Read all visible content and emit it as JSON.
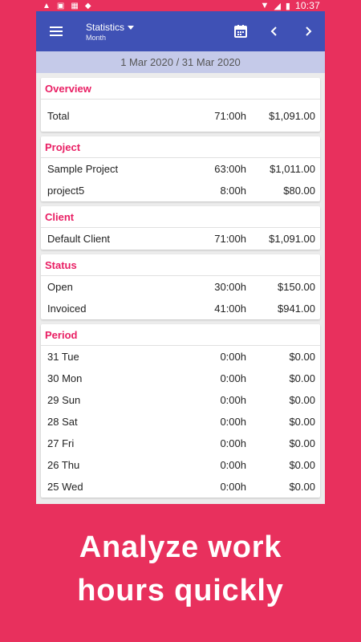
{
  "status_bar": {
    "time": "10:37"
  },
  "appbar": {
    "title": "Statistics",
    "subtitle": "Month",
    "icons": [
      "menu-icon",
      "calendar-icon",
      "chevron-left-icon",
      "chevron-right-icon"
    ]
  },
  "date_range": "1 Mar 2020 / 31 Mar 2020",
  "overview": {
    "title": "Overview",
    "rows": [
      {
        "label": "Total",
        "hours": "71:00h",
        "amount": "$1,091.00"
      }
    ]
  },
  "project": {
    "title": "Project",
    "rows": [
      {
        "label": "Sample Project",
        "hours": "63:00h",
        "amount": "$1,011.00"
      },
      {
        "label": "project5",
        "hours": "8:00h",
        "amount": "$80.00"
      }
    ]
  },
  "client": {
    "title": "Client",
    "rows": [
      {
        "label": "Default Client",
        "hours": "71:00h",
        "amount": "$1,091.00"
      }
    ]
  },
  "status": {
    "title": "Status",
    "rows": [
      {
        "label": "Open",
        "hours": "30:00h",
        "amount": "$150.00"
      },
      {
        "label": "Invoiced",
        "hours": "41:00h",
        "amount": "$941.00"
      }
    ]
  },
  "period": {
    "title": "Period",
    "rows": [
      {
        "label": "31 Tue",
        "hours": "0:00h",
        "amount": "$0.00"
      },
      {
        "label": "30 Mon",
        "hours": "0:00h",
        "amount": "$0.00"
      },
      {
        "label": "29 Sun",
        "hours": "0:00h",
        "amount": "$0.00"
      },
      {
        "label": "28 Sat",
        "hours": "0:00h",
        "amount": "$0.00"
      },
      {
        "label": "27 Fri",
        "hours": "0:00h",
        "amount": "$0.00"
      },
      {
        "label": "26 Thu",
        "hours": "0:00h",
        "amount": "$0.00"
      },
      {
        "label": "25 Wed",
        "hours": "0:00h",
        "amount": "$0.00"
      }
    ]
  },
  "caption": {
    "line1": "Analyze work",
    "line2": "hours quickly"
  },
  "colors": {
    "background": "#e8305d",
    "appbar": "#3f51b5",
    "date_band": "#c5cae9",
    "section_title": "#e91e63"
  }
}
